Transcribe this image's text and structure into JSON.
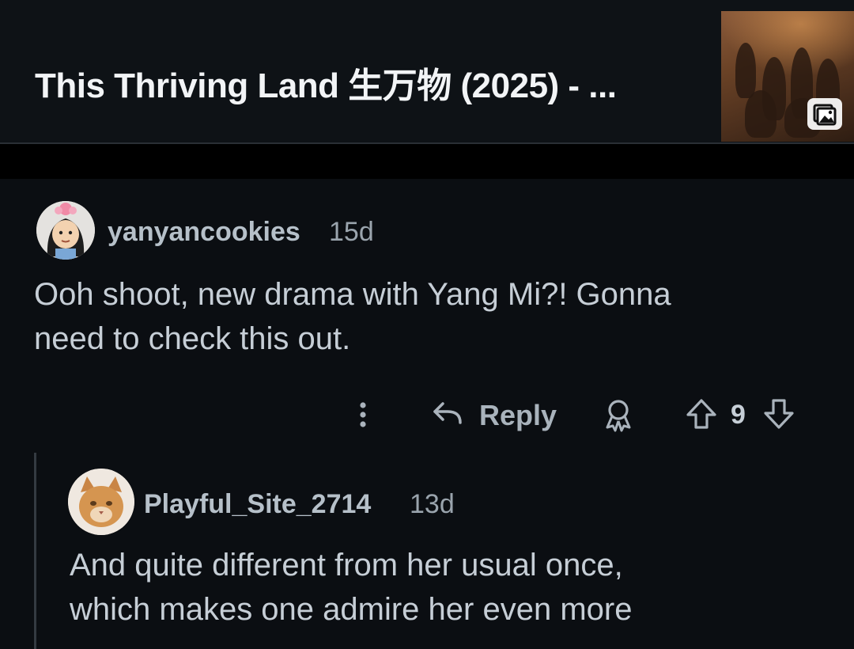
{
  "post": {
    "title": "This Thriving Land 生万物 (2025) - ...",
    "thumbnail_icon": "image-icon"
  },
  "comments": [
    {
      "username": "yanyancookies",
      "age": "15d",
      "body_line1": "Ooh shoot, new drama with Yang Mi?! Gonna",
      "body_line2": "need to check this out.",
      "actions": {
        "more_icon": "more-vertical-icon",
        "reply_label": "Reply",
        "award_icon": "award-icon",
        "upvote_icon": "arrow-up-icon",
        "score": "9",
        "downvote_icon": "arrow-down-icon"
      }
    },
    {
      "username": "Playful_Site_2714",
      "age": "13d",
      "body_line1": "And quite different from her usual once,",
      "body_line2": "which makes one admire her even more"
    }
  ],
  "colors": {
    "background": "#0b0e12",
    "username": "#b6c0c9",
    "body": "#c6ced6",
    "thread_line": "#343a41"
  }
}
